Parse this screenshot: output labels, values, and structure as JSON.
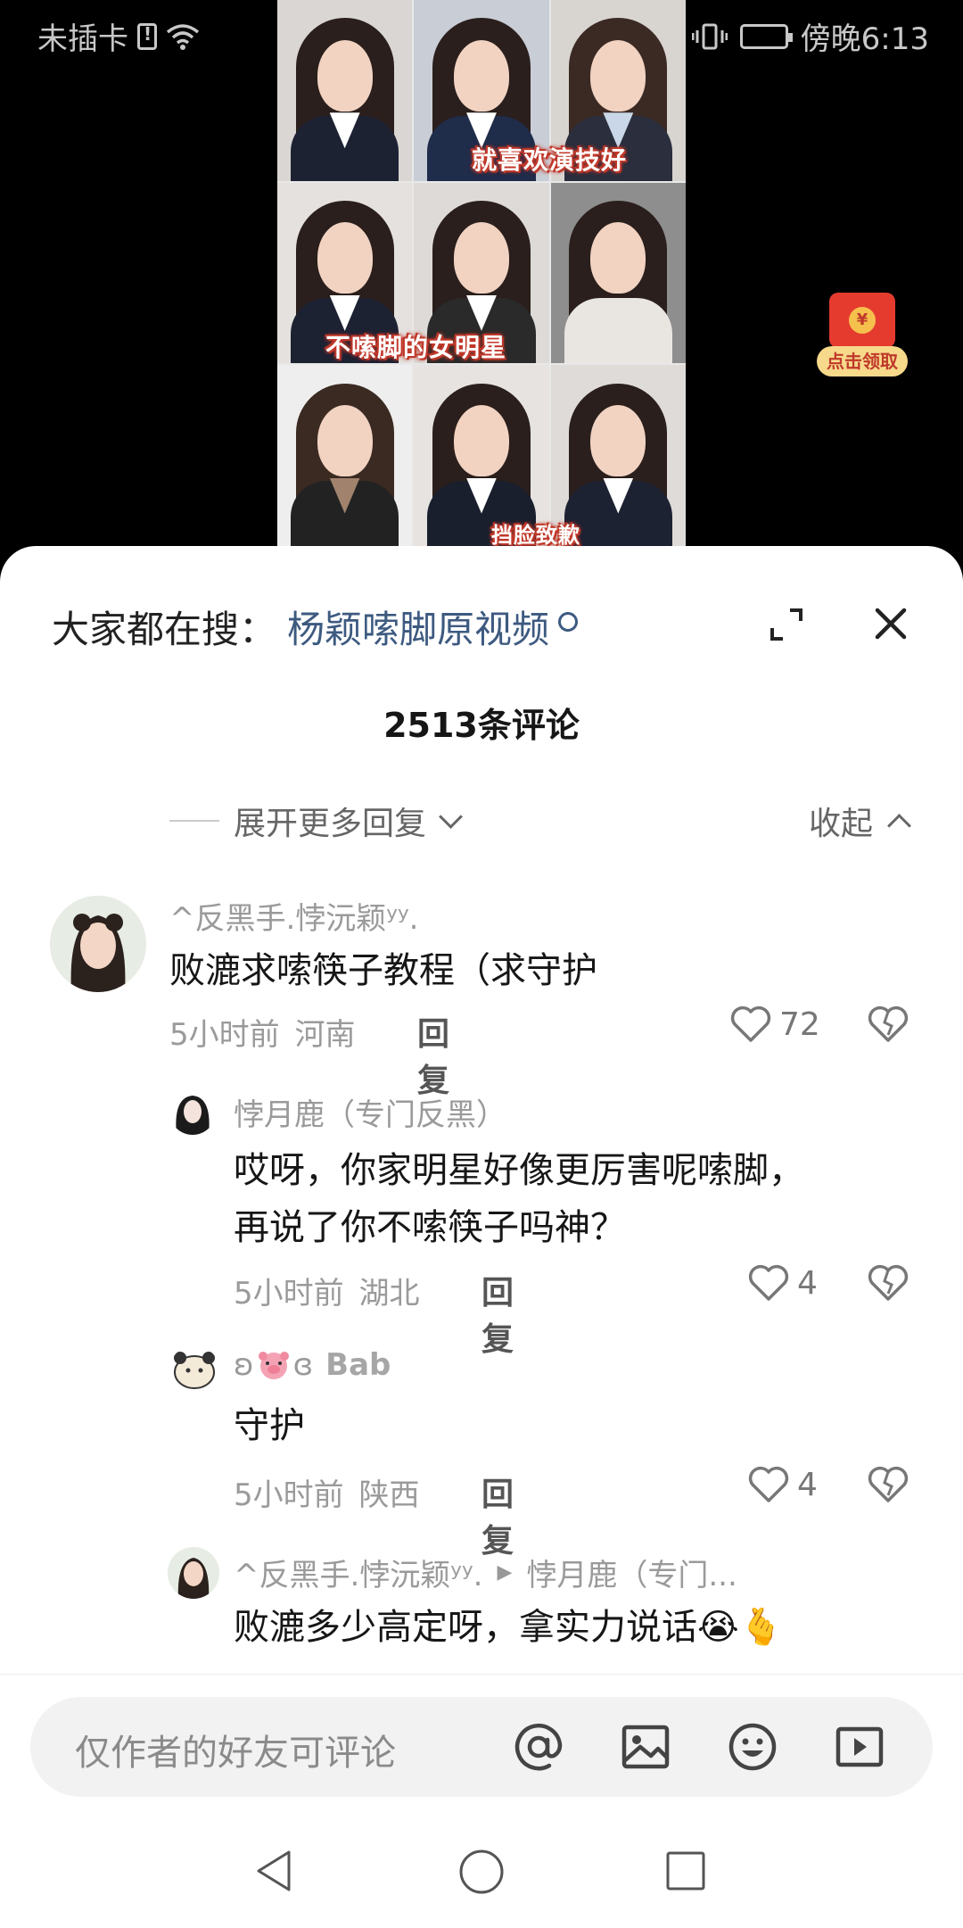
{
  "status_bar": {
    "carrier": "未插卡",
    "time": "傍晚6:13"
  },
  "video": {
    "captions": [
      "就喜欢演技好",
      "不嗦脚的女明星",
      "挡脸致歉"
    ],
    "red_packet_label": "点击领取",
    "red_packet_symbol": "¥"
  },
  "sheet": {
    "search_prefix": "大家都在搜：",
    "search_term": "杨颖嗦脚原视频",
    "comment_count": "2513条评论",
    "expand_more": "展开更多回复",
    "collapse": "收起"
  },
  "comments": [
    {
      "username": "^反黑手.悖沅颖ʸʸ.",
      "text": "败漉求嗦筷子教程（求守护",
      "time": "5小时前",
      "location": "河南",
      "reply_label": "回复",
      "likes": "72"
    },
    {
      "username": "悖月鹿（专门反黑）",
      "text_line1": "哎呀，你家明星好像更厉害呢嗦脚，",
      "text_line2": "再说了你不嗦筷子吗神？",
      "time": "5小时前",
      "location": "湖北",
      "reply_label": "回复",
      "likes": "4"
    },
    {
      "username_prefix": "ʚ",
      "username_suffix": "ɞ",
      "username_name": "Bab",
      "text": "守护",
      "time": "5小时前",
      "location": "陕西",
      "reply_label": "回复",
      "likes": "4"
    },
    {
      "username": "^反黑手.悖沅颖ʸʸ.",
      "reply_to": "悖月鹿（专门...",
      "text": "败漉多少高定呀，拿实力说话😭🫰"
    }
  ],
  "input": {
    "placeholder": "仅作者的好友可评论"
  },
  "colors": {
    "search_term": "#3d5a80",
    "red_packet": "#e53b2f",
    "caption_outline": "#c0392b"
  }
}
